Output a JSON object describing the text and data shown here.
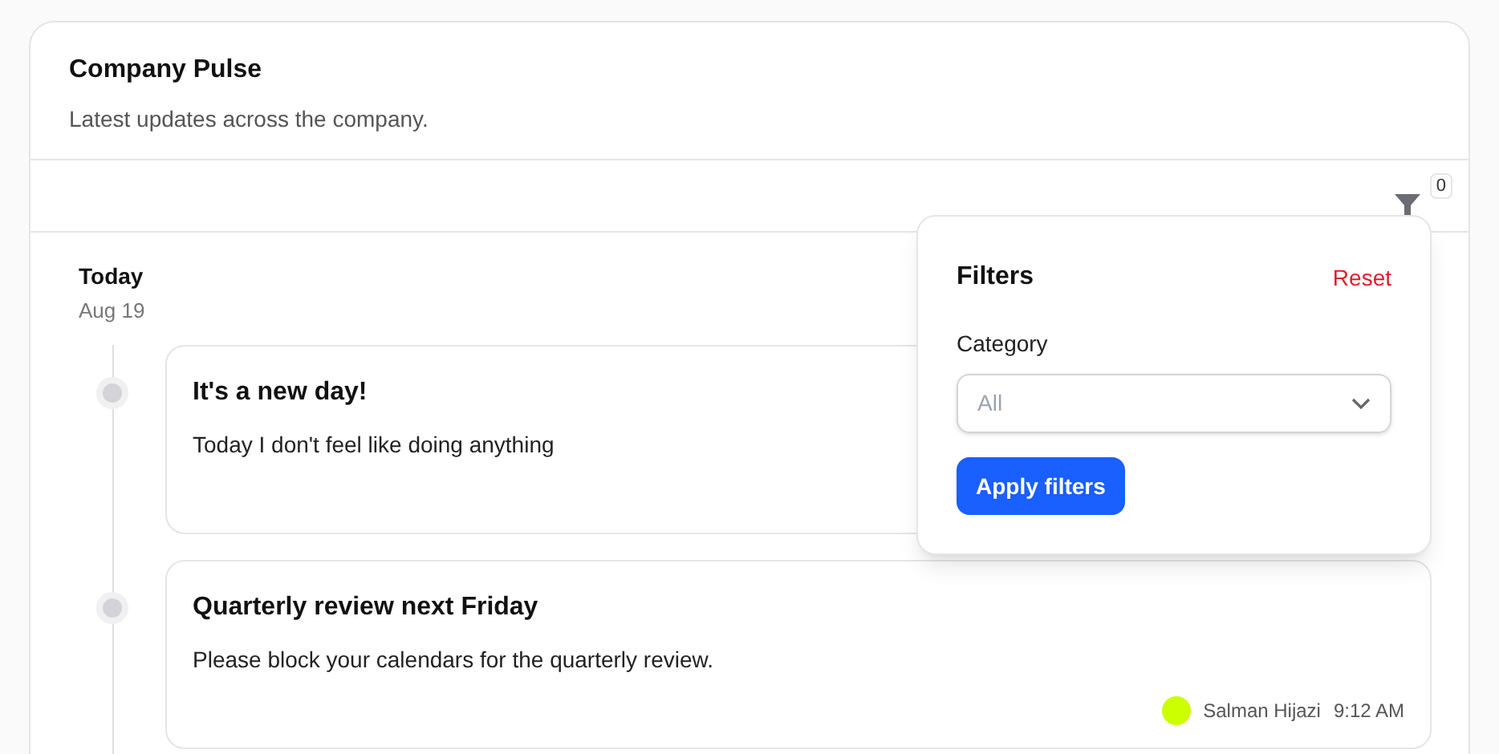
{
  "header": {
    "title": "Company Pulse",
    "subtitle": "Latest updates across the company."
  },
  "filter_button": {
    "count": "0"
  },
  "groups": [
    {
      "label": "Today",
      "date": "Aug 19",
      "posts": [
        {
          "title": "It's a new day!",
          "body": "Today I don't feel like doing anything"
        },
        {
          "title": "Quarterly review next Friday",
          "body": "Please block your calendars for the quarterly review.",
          "author": "Salman Hijazi",
          "time": "9:12 AM"
        }
      ]
    }
  ],
  "filters_popover": {
    "title": "Filters",
    "reset": "Reset",
    "category_label": "Category",
    "category_placeholder": "All",
    "apply": "Apply filters"
  }
}
